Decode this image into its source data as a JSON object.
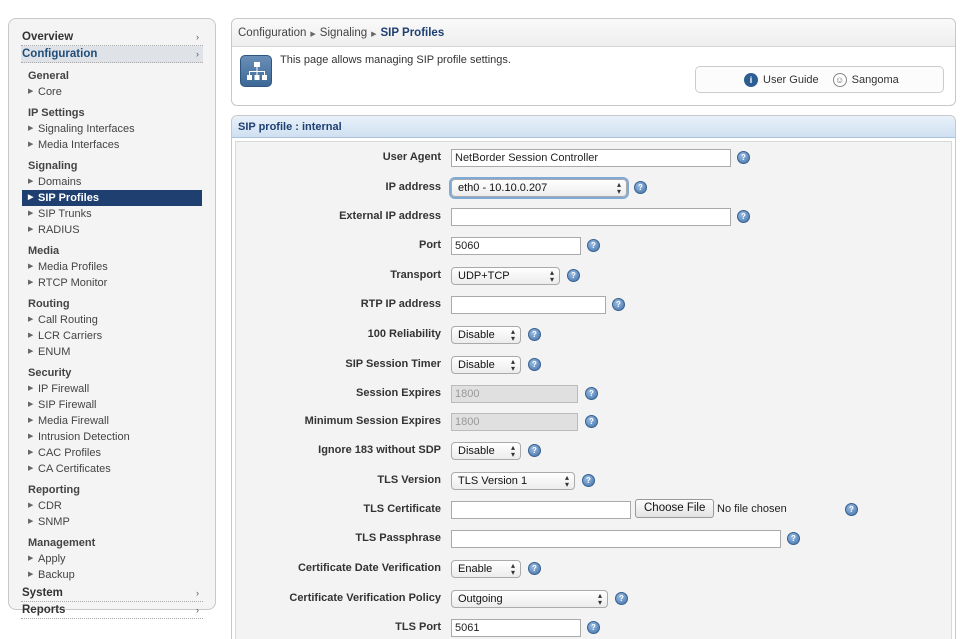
{
  "sidebar": {
    "overview": "Overview",
    "configuration": "Configuration",
    "groups": [
      {
        "title": "General",
        "items": [
          "Core"
        ]
      },
      {
        "title": "IP Settings",
        "items": [
          "Signaling Interfaces",
          "Media Interfaces"
        ]
      },
      {
        "title": "Signaling",
        "items": [
          "Domains",
          "SIP Profiles",
          "SIP Trunks",
          "RADIUS"
        ]
      },
      {
        "title": "Media",
        "items": [
          "Media Profiles",
          "RTCP Monitor"
        ]
      },
      {
        "title": "Routing",
        "items": [
          "Call Routing",
          "LCR Carriers",
          "ENUM"
        ]
      },
      {
        "title": "Security",
        "items": [
          "IP Firewall",
          "SIP Firewall",
          "Media Firewall",
          "Intrusion Detection",
          "CAC Profiles",
          "CA Certificates"
        ]
      },
      {
        "title": "Reporting",
        "items": [
          "CDR",
          "SNMP"
        ]
      },
      {
        "title": "Management",
        "items": [
          "Apply",
          "Backup"
        ]
      }
    ],
    "system": "System",
    "reports": "Reports",
    "selected": "SIP Profiles"
  },
  "breadcrumb": {
    "a": "Configuration",
    "b": "Signaling",
    "current": "SIP Profiles"
  },
  "info": {
    "text": "This page allows managing SIP profile settings.",
    "user_guide": "User Guide",
    "user": "Sangoma"
  },
  "form": {
    "title": "SIP profile : internal",
    "user_agent": {
      "label": "User Agent",
      "value": "NetBorder Session Controller"
    },
    "ip_address": {
      "label": "IP address",
      "value": "eth0 - 10.10.0.207"
    },
    "external_ip": {
      "label": "External IP address",
      "value": ""
    },
    "port": {
      "label": "Port",
      "value": "5060"
    },
    "transport": {
      "label": "Transport",
      "value": "UDP+TCP"
    },
    "rtp_ip": {
      "label": "RTP IP address",
      "value": ""
    },
    "reliability": {
      "label": "100 Reliability",
      "value": "Disable"
    },
    "session_timer": {
      "label": "SIP Session Timer",
      "value": "Disable"
    },
    "session_expires": {
      "label": "Session Expires",
      "value": "1800"
    },
    "min_session_expires": {
      "label": "Minimum Session Expires",
      "value": "1800"
    },
    "ignore_183": {
      "label": "Ignore 183 without SDP",
      "value": "Disable"
    },
    "tls_version": {
      "label": "TLS Version",
      "value": "TLS Version 1"
    },
    "tls_certificate": {
      "label": "TLS Certificate",
      "button": "Choose File",
      "note": "No file chosen"
    },
    "tls_passphrase": {
      "label": "TLS Passphrase",
      "value": ""
    },
    "cert_date": {
      "label": "Certificate Date Verification",
      "value": "Enable"
    },
    "cert_policy": {
      "label": "Certificate Verification Policy",
      "value": "Outgoing"
    },
    "tls_port": {
      "label": "TLS Port",
      "value": "5061"
    }
  },
  "colors": {
    "nav_selected": "#1e3f70",
    "title_blue": "#1e3f70",
    "help_icon": "#3f6fa8"
  },
  "icons": {
    "help": "question-mark-icon",
    "info": "info-icon",
    "user": "user-icon",
    "page": "network-icon"
  }
}
